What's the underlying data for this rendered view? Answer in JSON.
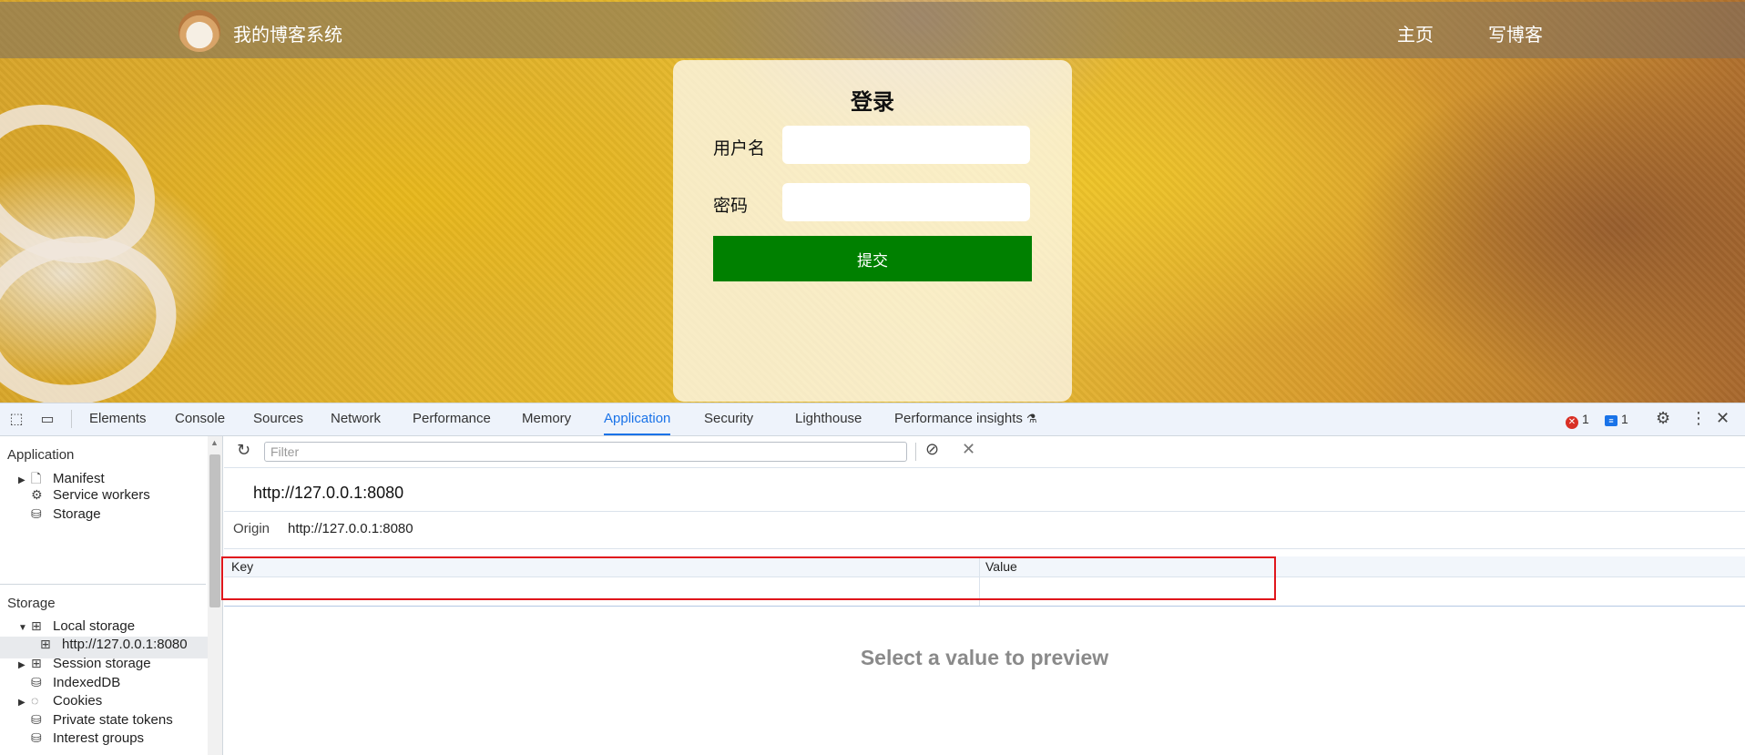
{
  "site": {
    "brand": "我的博客系统",
    "nav": {
      "home": "主页",
      "write": "写博客"
    },
    "login": {
      "title": "登录",
      "username_label": "用户名",
      "password_label": "密码",
      "username_value": "",
      "password_value": "",
      "submit_label": "提交"
    },
    "colors": {
      "submit": "#008000"
    }
  },
  "devtools": {
    "tabs": [
      "Elements",
      "Console",
      "Sources",
      "Network",
      "Performance",
      "Memory",
      "Application",
      "Security",
      "Lighthouse",
      "Performance insights"
    ],
    "active_tab": "Application",
    "error_count": "1",
    "message_count": "1",
    "sidebar": {
      "application_section": "Application",
      "application_items": [
        "Manifest",
        "Service workers",
        "Storage"
      ],
      "storage_section": "Storage",
      "storage_items": {
        "local_storage": "Local storage",
        "local_origin": "http://127.0.0.1:8080",
        "session_storage": "Session storage",
        "indexeddb": "IndexedDB",
        "cookies": "Cookies",
        "private_state_tokens": "Private state tokens",
        "interest_groups": "Interest groups"
      }
    },
    "filter_placeholder": "Filter",
    "origin_header": "http://127.0.0.1:8080",
    "origin_label": "Origin",
    "origin_value": "http://127.0.0.1:8080",
    "table": {
      "key_header": "Key",
      "value_header": "Value"
    },
    "preview_text": "Select a value to preview"
  }
}
